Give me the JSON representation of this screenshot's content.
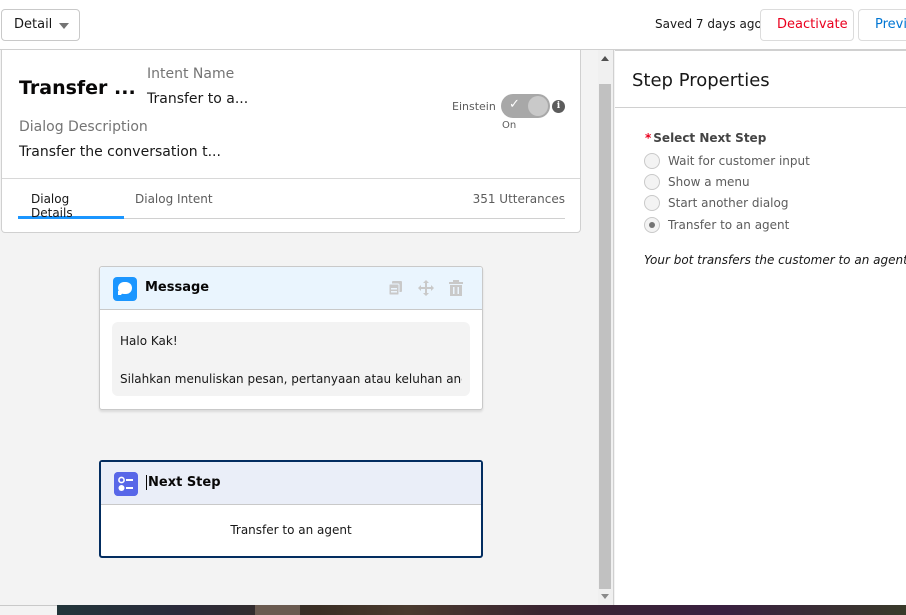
{
  "topbar": {
    "view_select": "Detail",
    "saved_status": "Saved 7 days ago",
    "deactivate_label": "Deactivate",
    "preview_label": "Preview"
  },
  "dialog": {
    "title": "Transfer ...",
    "intent_name_label": "Intent Name",
    "intent_name_value": "Transfer to a...",
    "description_label": "Dialog Description",
    "description_value": "Transfer the conversation t...",
    "einstein_label": "Einstein",
    "einstein_toggle_state": "On",
    "einstein_enabled": true,
    "tabs": [
      {
        "label": "Dialog Details",
        "active": true
      },
      {
        "label": "Dialog Intent",
        "active": false
      }
    ],
    "utterances": "351 Utterances"
  },
  "steps": [
    {
      "type": "message",
      "title": "Message",
      "icon": "chat-bubble-icon",
      "accent": "#1b96ff",
      "body_line1": "Halo Kak!",
      "body_line2": "Silahkan menuliskan pesan, pertanyaan atau keluhan and...",
      "actions": [
        "copy-icon",
        "move-icon",
        "trash-icon"
      ]
    },
    {
      "type": "next-step",
      "title": "Next Step",
      "icon": "next-step-icon",
      "accent": "#5867e8",
      "value": "Transfer to an agent",
      "selected": true
    }
  ],
  "step_properties": {
    "title": "Step Properties",
    "field_label": "Select Next Step",
    "required": true,
    "options": [
      {
        "label": "Wait for customer input",
        "checked": false
      },
      {
        "label": "Show a menu",
        "checked": false
      },
      {
        "label": "Start another dialog",
        "checked": false
      },
      {
        "label": "Transfer to an agent",
        "checked": true
      }
    ],
    "help_text": "Your bot transfers the customer to an agent."
  }
}
